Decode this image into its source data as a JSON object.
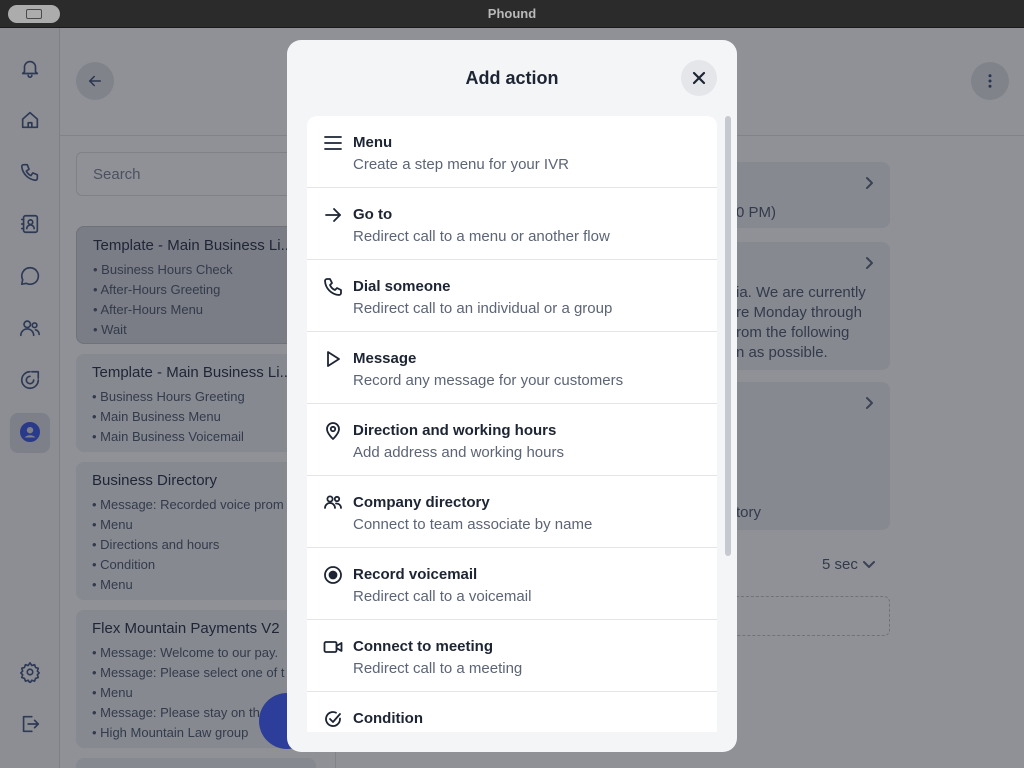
{
  "window": {
    "title": "Phound"
  },
  "rail": {
    "icons": [
      "bell-icon",
      "home-icon",
      "phone-icon",
      "contacts-icon",
      "chat-icon",
      "team-icon",
      "flows-icon",
      "profile-icon",
      "settings-icon",
      "logout-icon"
    ]
  },
  "left": {
    "search_placeholder": "Search",
    "cards": [
      {
        "title": "Template - Main Business Li...",
        "items": [
          "• Business Hours Check",
          "• After-Hours Greeting",
          "• After-Hours Menu",
          "• Wait"
        ]
      },
      {
        "title": "Template - Main Business Li...",
        "items": [
          "• Business Hours Greeting",
          "• Main Business Menu",
          "• Main Business Voicemail"
        ]
      },
      {
        "title": "Business Directory",
        "items": [
          "• Message: Recorded voice prom",
          "• Menu",
          "• Directions and hours",
          "• Condition",
          "• Menu"
        ]
      },
      {
        "title": "Flex Mountain Payments V2",
        "items": [
          "• Message: Welcome to our pay.",
          "• Message: Please select one of t",
          "• Menu",
          "• Message: Please stay on th",
          "• High Mountain Law group"
        ]
      }
    ]
  },
  "right": {
    "snippets": [
      "0 PM)",
      "ia. We are currently",
      "re Monday through",
      "rom the following",
      "n as possible.",
      "tory"
    ],
    "wait_value": "5 sec"
  },
  "modal": {
    "title": "Add action",
    "actions": [
      {
        "icon": "menu-icon",
        "title": "Menu",
        "desc": "Create a step menu for your IVR"
      },
      {
        "icon": "arrow-right-icon",
        "title": "Go to",
        "desc": "Redirect call to a menu or another flow"
      },
      {
        "icon": "phone-icon",
        "title": "Dial someone",
        "desc": "Redirect call to an individual or a group"
      },
      {
        "icon": "play-icon",
        "title": "Message",
        "desc": "Record any message for your customers"
      },
      {
        "icon": "location-pin-icon",
        "title": "Direction and working hours",
        "desc": "Add address and working hours"
      },
      {
        "icon": "people-icon",
        "title": "Company directory",
        "desc": "Connect to team associate by name"
      },
      {
        "icon": "record-icon",
        "title": "Record voicemail",
        "desc": "Redirect call to a voicemail"
      },
      {
        "icon": "video-icon",
        "title": "Connect to meeting",
        "desc": "Redirect call to a meeting"
      },
      {
        "icon": "check-circle-icon",
        "title": "Condition",
        "desc": ""
      }
    ]
  }
}
